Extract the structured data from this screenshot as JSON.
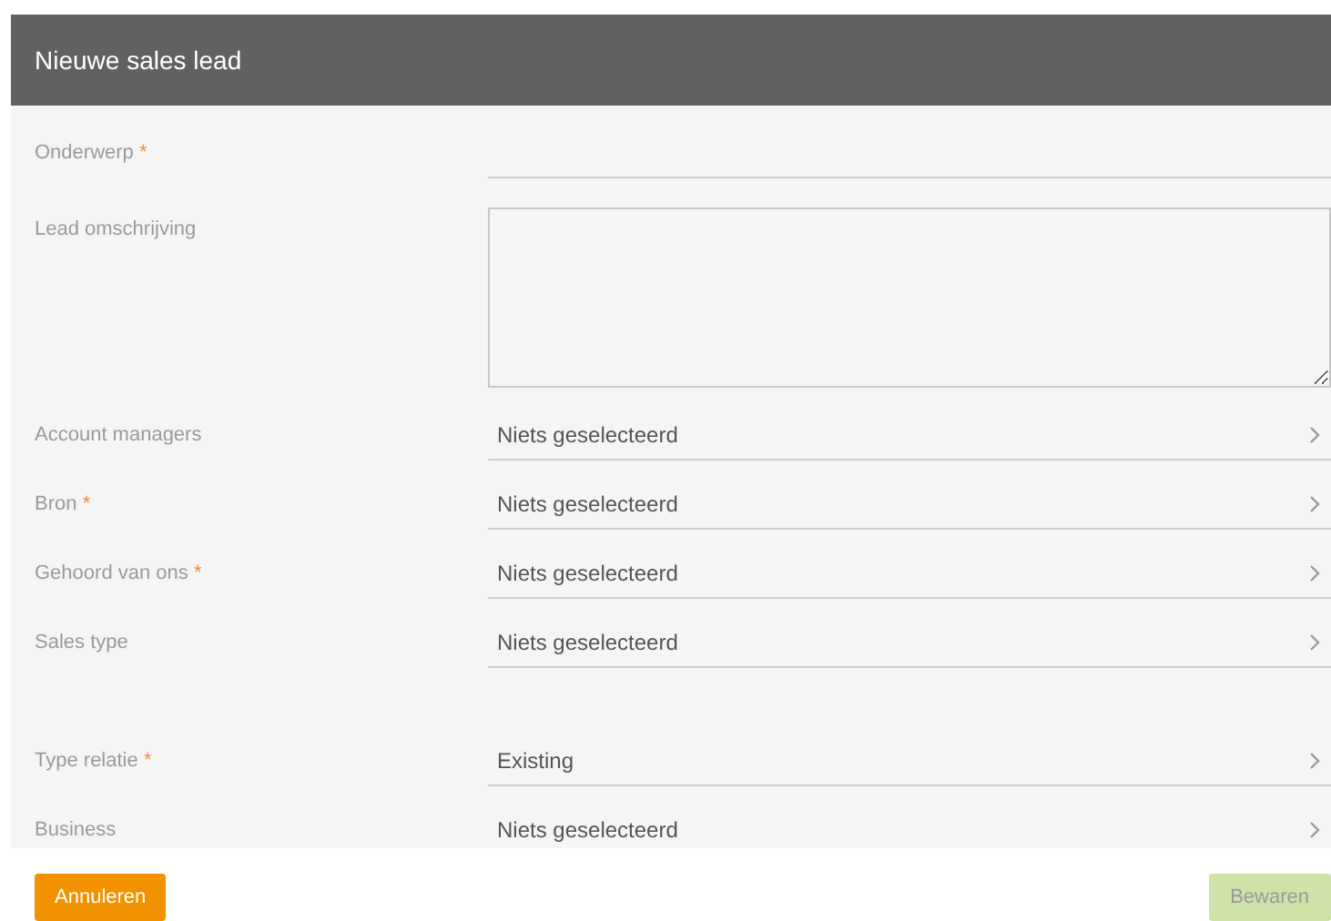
{
  "dialog": {
    "title": "Nieuwe sales lead"
  },
  "fields": [
    {
      "kind": "text",
      "label": "Onderwerp",
      "required_mark": "*"
    },
    {
      "kind": "textarea",
      "label": "Lead omschrijving"
    },
    {
      "kind": "select",
      "label": "Account managers",
      "value": "Niets geselecteerd"
    },
    {
      "kind": "select",
      "label": "Bron",
      "required_mark": "*",
      "value": "Niets geselecteerd"
    },
    {
      "kind": "select",
      "label": "Gehoord van ons",
      "required_mark": "*",
      "value": "Niets geselecteerd"
    },
    {
      "kind": "select",
      "label": "Sales type",
      "value": "Niets geselecteerd"
    },
    {
      "kind": "divider"
    },
    {
      "kind": "select",
      "label": "Type relatie",
      "required_mark": "*",
      "value": "Existing"
    },
    {
      "kind": "select",
      "label": "Business",
      "value": "Niets geselecteerd"
    }
  ],
  "buttons": [
    {
      "kind": "cancel",
      "label": "Annuleren"
    },
    {
      "kind": "save",
      "label": "Bewaren",
      "disabled": true
    }
  ]
}
